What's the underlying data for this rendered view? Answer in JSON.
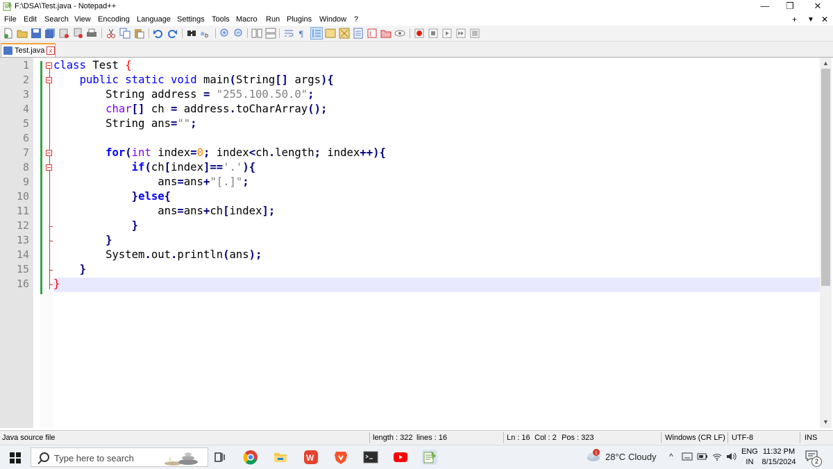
{
  "window": {
    "title": "F:\\DSA\\Test.java - Notepad++",
    "controls": {
      "minimize": "—",
      "restore": "❐",
      "close": "✕"
    }
  },
  "menu": {
    "items": [
      "File",
      "Edit",
      "Search",
      "View",
      "Encoding",
      "Language",
      "Settings",
      "Tools",
      "Macro",
      "Run",
      "Plugins",
      "Window",
      "?"
    ],
    "right": {
      "plus": "+",
      "dropdown": "▼",
      "close": "✕"
    }
  },
  "tab": {
    "label": "Test.java",
    "close": "x"
  },
  "editor": {
    "line_numbers": [
      "1",
      "2",
      "3",
      "4",
      "5",
      "6",
      "7",
      "8",
      "9",
      "10",
      "11",
      "12",
      "13",
      "14",
      "15",
      "16"
    ],
    "current_line": 16
  },
  "status": {
    "file_type": "Java source file",
    "length": "length : 322",
    "lines": "lines : 16",
    "ln": "Ln : 16",
    "col": "Col : 2",
    "pos": "Pos : 323",
    "eol": "Windows (CR LF)",
    "encoding": "UTF-8",
    "mode": "INS"
  },
  "taskbar": {
    "search_placeholder": "Type here to search",
    "weather_temp": "28°C",
    "weather_text": "Cloudy",
    "lang_top": "ENG",
    "lang_bottom": "IN",
    "time": "11:32 PM",
    "date": "8/15/2024",
    "notification_count": "2",
    "weather_badge": "1",
    "apps": [
      "task-view",
      "chrome",
      "file-explorer",
      "wps-office",
      "brave",
      "terminal",
      "youtube",
      "notepad-plus-plus"
    ]
  },
  "colors": {
    "keyword": "#0000ff",
    "type": "#8000ff",
    "string": "#808080",
    "number": "#ff8000",
    "operator": "#000080",
    "brace": "#ff0000",
    "current_line": "#e8e8ff",
    "change_bar": "#35a346"
  }
}
